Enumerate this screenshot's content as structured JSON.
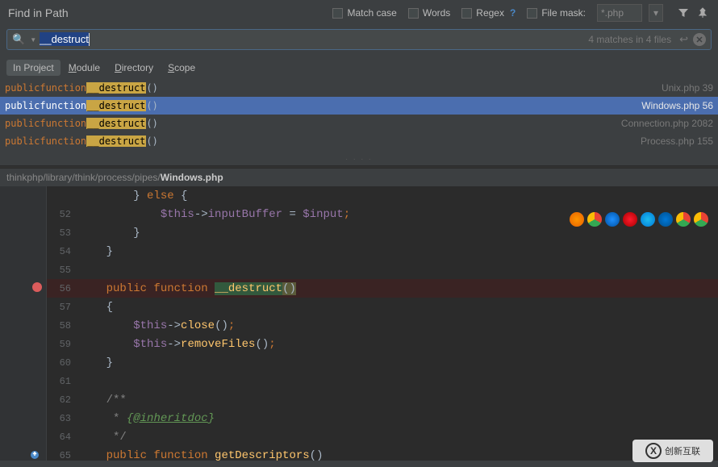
{
  "header": {
    "title": "Find in Path",
    "match_case": "Match case",
    "words": "Words",
    "regex": "Regex",
    "regex_help": "?",
    "file_mask": "File mask:",
    "mask_value": "*.php"
  },
  "search": {
    "query": "__destruct",
    "status": "4 matches in 4 files"
  },
  "tabs": {
    "project": "In Project",
    "module": "Module",
    "directory": "Directory",
    "scope": "Scope"
  },
  "results": [
    {
      "prefix": "public function ",
      "match": "__destruct",
      "suffix": "()",
      "file": "Unix.php",
      "line": "39",
      "selected": false
    },
    {
      "prefix": "public function ",
      "match": "__destruct",
      "suffix": "()",
      "file": "Windows.php",
      "line": "56",
      "selected": true
    },
    {
      "prefix": "public function ",
      "match": "__destruct",
      "suffix": "()",
      "file": "Connection.php",
      "line": "2082",
      "selected": false
    },
    {
      "prefix": "public function ",
      "match": "__destruct",
      "suffix": "()",
      "file": "Process.php",
      "line": "155",
      "selected": false
    }
  ],
  "preview": {
    "path_prefix": "thinkphp/library/think/process/pipes/",
    "path_file": "Windows.php",
    "lines": [
      {
        "n": "",
        "html": "        } else {"
      },
      {
        "n": "52",
        "html": "            $this->inputBuffer = $input;"
      },
      {
        "n": "53",
        "html": "        }"
      },
      {
        "n": "54",
        "html": "    }"
      },
      {
        "n": "55",
        "html": ""
      },
      {
        "n": "56",
        "html": "    public function __destruct()"
      },
      {
        "n": "57",
        "html": "    {"
      },
      {
        "n": "58",
        "html": "        $this->close();"
      },
      {
        "n": "59",
        "html": "        $this->removeFiles();"
      },
      {
        "n": "60",
        "html": "    }"
      },
      {
        "n": "61",
        "html": ""
      },
      {
        "n": "62",
        "html": "    /**"
      },
      {
        "n": "63",
        "html": "     * {@inheritdoc}"
      },
      {
        "n": "64",
        "html": "     */"
      },
      {
        "n": "65",
        "html": "    public function getDescriptors()"
      }
    ]
  },
  "watermark": "创新互联"
}
